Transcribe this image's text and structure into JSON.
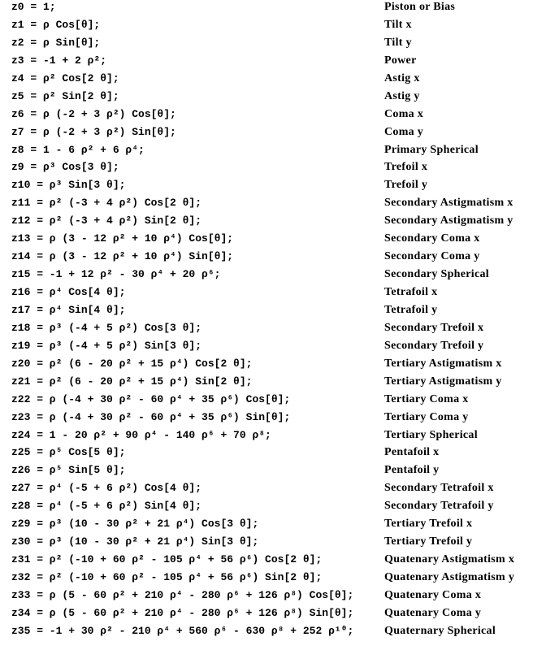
{
  "rows": [
    {
      "formula": "z0 = 1;",
      "name": "Piston or Bias"
    },
    {
      "formula": "z1 = ρ Cos[θ];",
      "name": "Tilt x"
    },
    {
      "formula": "z2 = ρ Sin[θ];",
      "name": "Tilt y"
    },
    {
      "formula": "z3 = -1 + 2 ρ²;",
      "name": "Power"
    },
    {
      "formula": "z4 = ρ² Cos[2 θ];",
      "name": "Astig x"
    },
    {
      "formula": "z5 = ρ² Sin[2 θ];",
      "name": "Astig y"
    },
    {
      "formula": "z6 = ρ (-2 + 3 ρ²) Cos[θ];",
      "name": "Coma x"
    },
    {
      "formula": "z7 = ρ (-2 + 3 ρ²) Sin[θ];",
      "name": "Coma y"
    },
    {
      "formula": "z8 = 1 - 6 ρ² + 6 ρ⁴;",
      "name": "Primary Spherical"
    },
    {
      "formula": "z9 = ρ³ Cos[3 θ];",
      "name": "Trefoil x"
    },
    {
      "formula": "z10 = ρ³ Sin[3 θ];",
      "name": "Trefoil y"
    },
    {
      "formula": "z11 = ρ² (-3 + 4 ρ²) Cos[2 θ];",
      "name": "Secondary Astigmatism x"
    },
    {
      "formula": "z12 = ρ² (-3 + 4 ρ²) Sin[2 θ];",
      "name": "Secondary Astigmatism y"
    },
    {
      "formula": "z13 = ρ (3 - 12 ρ² + 10 ρ⁴) Cos[θ];",
      "name": "Secondary Coma x"
    },
    {
      "formula": "z14 = ρ (3 - 12 ρ² + 10 ρ⁴) Sin[θ];",
      "name": "Secondary Coma y"
    },
    {
      "formula": "z15 = -1 + 12 ρ² - 30 ρ⁴ + 20 ρ⁶;",
      "name": "Secondary Spherical"
    },
    {
      "formula": "z16 =  ρ⁴ Cos[4 θ];",
      "name": "Tetrafoil x"
    },
    {
      "formula": "z17 =  ρ⁴ Sin[4 θ];",
      "name": "Tetrafoil y"
    },
    {
      "formula": "z18 = ρ³ (-4 + 5 ρ²) Cos[3 θ];",
      "name": "Secondary Trefoil x"
    },
    {
      "formula": "z19 = ρ³ (-4 + 5 ρ²) Sin[3 θ];",
      "name": "Secondary Trefoil y"
    },
    {
      "formula": "z20 = ρ² (6 - 20 ρ² + 15 ρ⁴) Cos[2 θ];",
      "name": "Tertiary Astigmatism x"
    },
    {
      "formula": "z21 = ρ² (6 - 20 ρ² + 15 ρ⁴) Sin[2 θ];",
      "name": "Tertiary Astigmatism y"
    },
    {
      "formula": "z22 = ρ (-4 + 30 ρ² - 60 ρ⁴ + 35 ρ⁶) Cos[θ];",
      "name": "Tertiary Coma x"
    },
    {
      "formula": "z23 = ρ (-4 + 30 ρ² - 60 ρ⁴ + 35 ρ⁶) Sin[θ];",
      "name": "Tertiary Coma y"
    },
    {
      "formula": "z24 = 1 - 20 ρ² + 90 ρ⁴ - 140 ρ⁶ + 70 ρ⁸;",
      "name": "Tertiary Spherical"
    },
    {
      "formula": "z25 = ρ⁵ Cos[5 θ];",
      "name": "Pentafoil x"
    },
    {
      "formula": "z26 = ρ⁵ Sin[5 θ];",
      "name": "Pentafoil y"
    },
    {
      "formula": "z27 = ρ⁴ (-5 + 6 ρ²) Cos[4 θ];",
      "name": "Secondary Tetrafoil x"
    },
    {
      "formula": "z28 = ρ⁴ (-5 + 6 ρ²) Sin[4 θ];",
      "name": "Secondary Tetrafoil y"
    },
    {
      "formula": "z29 = ρ³ (10 - 30 ρ² + 21 ρ⁴) Cos[3 θ];",
      "name": "Tertiary Trefoil x"
    },
    {
      "formula": "z30 = ρ³ (10 - 30 ρ² + 21 ρ⁴) Sin[3 θ];",
      "name": "Tertiary Trefoil y"
    },
    {
      "formula": "z31 = ρ² (-10 + 60 ρ² - 105 ρ⁴ + 56 ρ⁶) Cos[2 θ];",
      "name": "Quatenary Astigmatism x"
    },
    {
      "formula": "z32 = ρ² (-10 + 60 ρ² - 105 ρ⁴ + 56 ρ⁶) Sin[2 θ];",
      "name": "Quatenary Astigmatism y"
    },
    {
      "formula": "z33 = ρ (5 - 60 ρ² + 210 ρ⁴ - 280 ρ⁶ + 126 ρ⁸) Cos[θ];",
      "name": "Quatenary Coma x"
    },
    {
      "formula": "z34 = ρ (5 - 60 ρ² + 210 ρ⁴ - 280 ρ⁶ + 126 ρ⁸) Sin[θ];",
      "name": "Quatenary Coma y"
    },
    {
      "formula": "z35 = -1 + 30 ρ² - 210 ρ⁴ + 560 ρ⁶ - 630 ρ⁸ + 252 ρ¹⁰;",
      "name": "Quaternary Spherical"
    }
  ]
}
